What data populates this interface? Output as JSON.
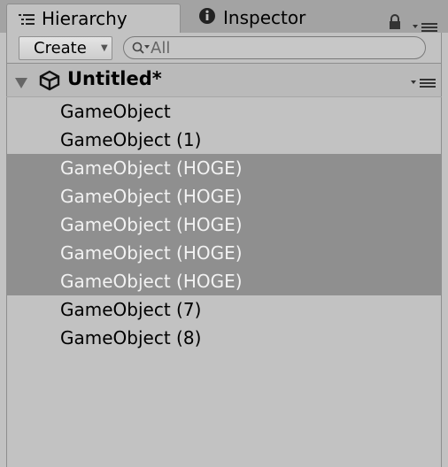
{
  "tabs": [
    {
      "label": "Hierarchy",
      "icon": "hierarchy-list-icon",
      "active": true
    },
    {
      "label": "Inspector",
      "icon": "info-icon",
      "active": false
    }
  ],
  "toolbar": {
    "create_label": "Create",
    "search_placeholder": "All"
  },
  "scene": {
    "title": "Untitled*"
  },
  "hierarchy": {
    "items": [
      {
        "label": "GameObject",
        "selected": false
      },
      {
        "label": "GameObject (1)",
        "selected": false
      },
      {
        "label": "GameObject (HOGE)",
        "selected": true
      },
      {
        "label": "GameObject (HOGE)",
        "selected": true
      },
      {
        "label": "GameObject (HOGE)",
        "selected": true
      },
      {
        "label": "GameObject (HOGE)",
        "selected": true
      },
      {
        "label": "GameObject (HOGE)",
        "selected": true
      },
      {
        "label": "GameObject (7)",
        "selected": false
      },
      {
        "label": "GameObject (8)",
        "selected": false
      }
    ]
  },
  "colors": {
    "panel_bg": "#c2c2c2",
    "selected_bg": "#8f8f8f",
    "selected_text": "#f2f2f2"
  }
}
